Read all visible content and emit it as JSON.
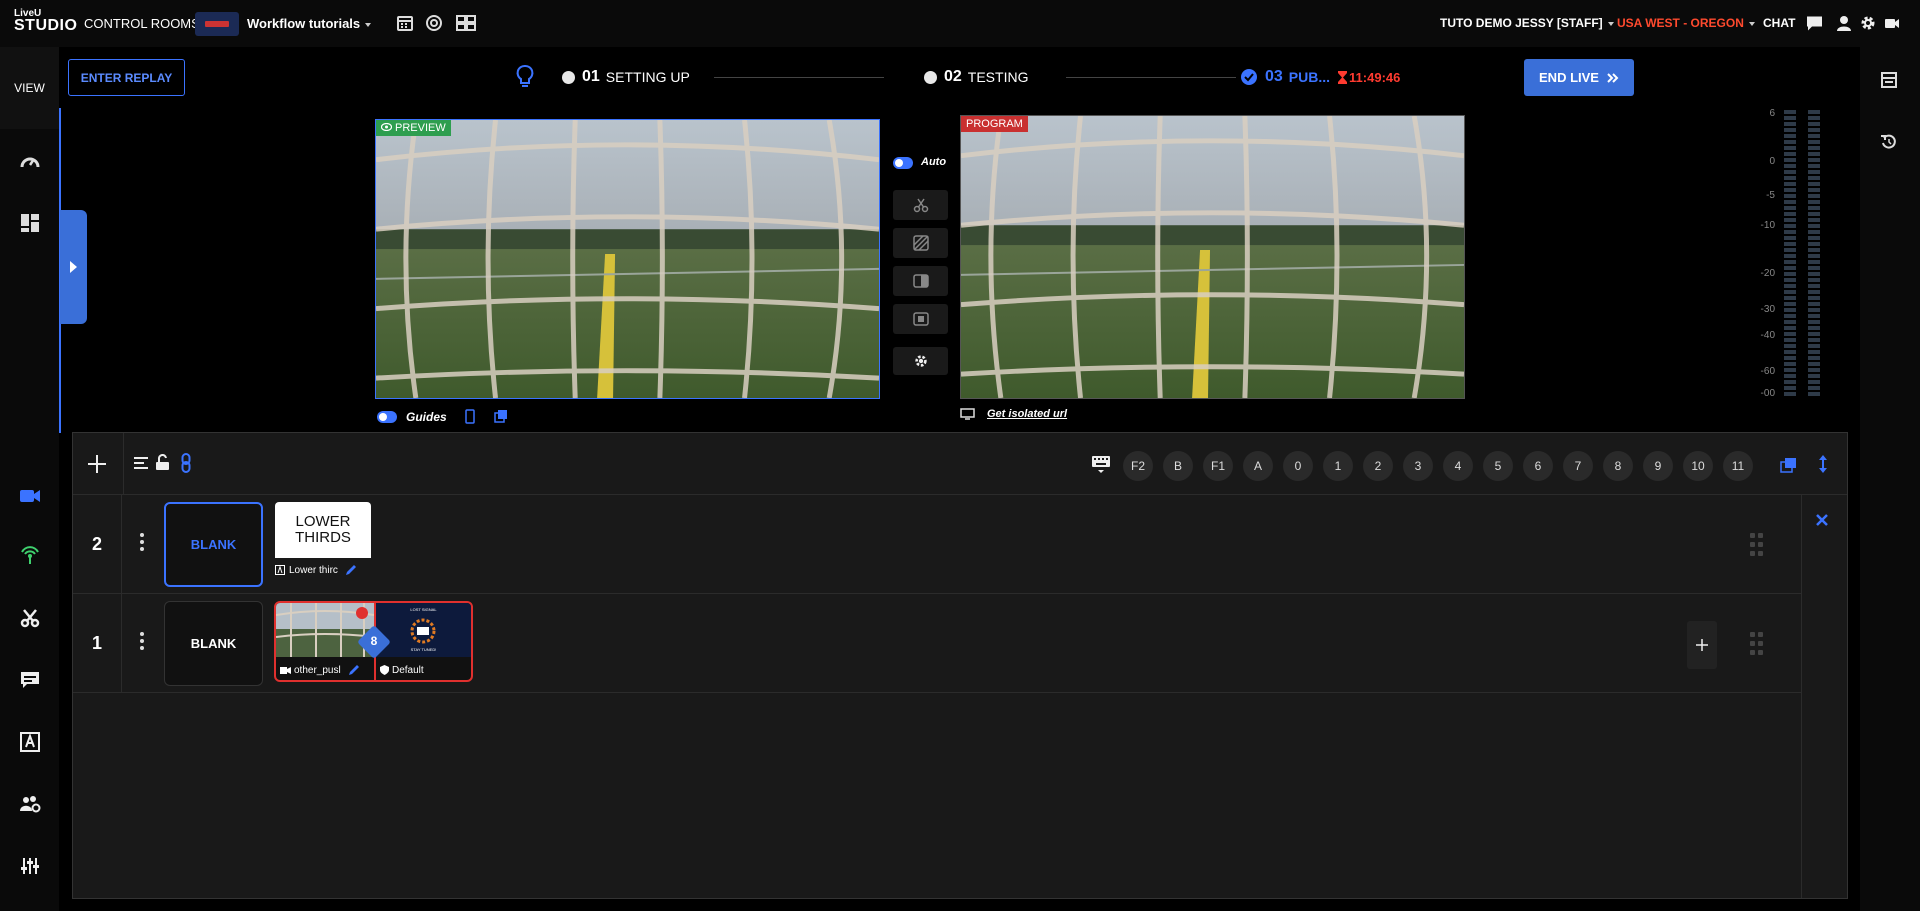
{
  "logo": {
    "line1": "LiveU",
    "line2": "STUDIO"
  },
  "topbar": {
    "control_rooms": "CONTROL ROOMS",
    "workspace_name": "Workflow tutorials",
    "user": "TUTO DEMO JESSY [STAFF]",
    "region": "USA WEST - OREGON",
    "chat": "CHAT"
  },
  "colors": {
    "accent": "#3a6fd8",
    "danger": "#e0302e",
    "preview": "#2e9e4f",
    "program": "#c93030"
  },
  "leftrail": {
    "view_label": "VIEW"
  },
  "controls": {
    "enter_replay": "ENTER REPLAY",
    "steps": [
      {
        "num": "01",
        "label": "SETTING UP"
      },
      {
        "num": "02",
        "label": "TESTING"
      },
      {
        "num": "03",
        "label": "PUB..."
      }
    ],
    "timer": "11:49:46",
    "end_live": "END LIVE"
  },
  "preview": {
    "label": "PREVIEW",
    "guides_label": "Guides"
  },
  "program": {
    "label": "PROGRAM",
    "isolated_url": "Get isolated url"
  },
  "transition": {
    "auto_label": "Auto"
  },
  "audio": {
    "scale": [
      "6",
      "0",
      "-5",
      "-10",
      "-20",
      "-30",
      "-40",
      "-60",
      "-00"
    ]
  },
  "panel": {
    "keys": [
      "F2",
      "B",
      "F1",
      "A",
      "0",
      "1",
      "2",
      "3",
      "4",
      "5",
      "6",
      "7",
      "8",
      "9",
      "10",
      "11"
    ],
    "layers": [
      {
        "number": "2",
        "blank_label": "BLANK",
        "card_title": "LOWER THIRDS",
        "card_caption": "Lower thirc"
      },
      {
        "number": "1",
        "blank_label": "BLANK",
        "source_caption": "other_pusl",
        "overlay_caption": "Default",
        "link_badge": "8",
        "overlay_text_top": "LOST SIGNAL",
        "overlay_text_bottom": "STAY TUNED!"
      }
    ]
  }
}
